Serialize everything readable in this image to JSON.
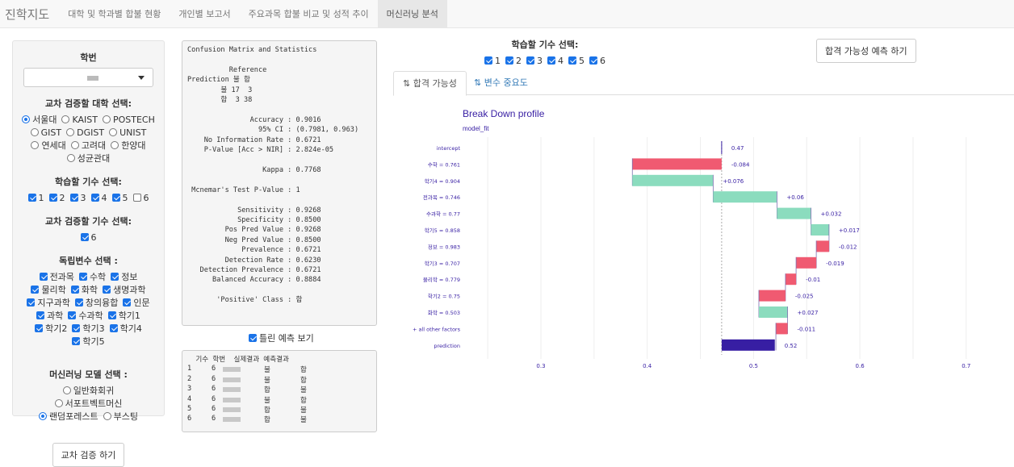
{
  "nav": {
    "brand": "진학지도",
    "items": [
      {
        "label": "대학 및 학과별 합불 현황"
      },
      {
        "label": "개인별 보고서"
      },
      {
        "label": "주요과목 합불 비교 및 성적 추이"
      },
      {
        "label": "머신러닝 분석",
        "active": true
      }
    ]
  },
  "sidebar": {
    "student_label": "학번",
    "univ_label": "교차 검증할 대학 선택:",
    "univs": [
      {
        "label": "서울대",
        "on": true
      },
      {
        "label": "KAIST"
      },
      {
        "label": "POSTECH"
      },
      {
        "label": "GIST"
      },
      {
        "label": "DGIST"
      },
      {
        "label": "UNIST"
      },
      {
        "label": "연세대"
      },
      {
        "label": "고려대"
      },
      {
        "label": "한양대"
      },
      {
        "label": "성균관대"
      }
    ],
    "train_label": "학습할 기수 선택:",
    "train": [
      {
        "label": "1",
        "on": true
      },
      {
        "label": "2",
        "on": true
      },
      {
        "label": "3",
        "on": true
      },
      {
        "label": "4",
        "on": true
      },
      {
        "label": "5",
        "on": true
      },
      {
        "label": "6",
        "on": false
      }
    ],
    "cv_label": "교차 검증할 기수 선택:",
    "cv": [
      {
        "label": "6",
        "on": true
      }
    ],
    "vars_label": "독립변수 선택 :",
    "vars": [
      {
        "label": "전과목"
      },
      {
        "label": "수학"
      },
      {
        "label": "정보"
      },
      {
        "label": "물리학"
      },
      {
        "label": "화학"
      },
      {
        "label": "생명과학"
      },
      {
        "label": "지구과학"
      },
      {
        "label": "창의융합"
      },
      {
        "label": "인문"
      },
      {
        "label": "과학"
      },
      {
        "label": "수과학"
      },
      {
        "label": "학기1"
      },
      {
        "label": "학기2"
      },
      {
        "label": "학기3"
      },
      {
        "label": "학기4"
      },
      {
        "label": "학기5"
      }
    ],
    "model_label": "머신러닝 모델 선택 :",
    "models": [
      {
        "label": "일반화회귀"
      },
      {
        "label": "서포트벡트머신"
      },
      {
        "label": "랜덤포레스트",
        "on": true
      },
      {
        "label": "부스팅"
      }
    ],
    "cv_button": "교차 검증 하기"
  },
  "confusion_text": "Confusion Matrix and Statistics\n\n          Reference\nPrediction 불 합\n        불 17  3\n        합  3 38\n\n               Accuracy : 0.9016\n                 95% CI : (0.7981, 0.963)\n    No Information Rate : 0.6721\n    P-Value [Acc > NIR] : 2.824e-05\n\n                  Kappa : 0.7768\n\n Mcnemar's Test P-Value : 1\n\n            Sensitivity : 0.9268\n            Specificity : 0.8500\n         Pos Pred Value : 0.9268\n         Neg Pred Value : 0.8500\n             Prevalence : 0.6721\n         Detection Rate : 0.6230\n   Detection Prevalence : 0.6721\n      Balanced Accuracy : 0.8884\n\n       'Positive' Class : 합",
  "wrong_label": "틀린 예측 보기",
  "wrong_header": "  기수 학번  실제결과 예측결과",
  "wrong_rows": [
    {
      "n": "1",
      "g": "6",
      "a": "불",
      "p": "합"
    },
    {
      "n": "2",
      "g": "6",
      "a": "불",
      "p": "합"
    },
    {
      "n": "3",
      "g": "6",
      "a": "합",
      "p": "불"
    },
    {
      "n": "4",
      "g": "6",
      "a": "불",
      "p": "합"
    },
    {
      "n": "5",
      "g": "6",
      "a": "합",
      "p": "불"
    },
    {
      "n": "6",
      "g": "6",
      "a": "합",
      "p": "불"
    }
  ],
  "right": {
    "train_label": "학습할 기수 선택:",
    "train": [
      {
        "label": "1"
      },
      {
        "label": "2"
      },
      {
        "label": "3"
      },
      {
        "label": "4"
      },
      {
        "label": "5"
      },
      {
        "label": "6"
      }
    ],
    "predict_button": "합격 가능성 예측 하기",
    "tabs": [
      {
        "label": "합격 가능성",
        "icon": "sort-icon",
        "active": true
      },
      {
        "label": "변수 중요도",
        "icon": "sort-icon"
      }
    ]
  },
  "chart_data": {
    "type": "bar",
    "title": "Break Down profile",
    "subtitle": "model_fit",
    "xlim": [
      0.25,
      0.72
    ],
    "xticks": [
      "0.3",
      "0.4",
      "0.5",
      "0.6",
      "0.7"
    ],
    "grid": true,
    "categories": [
      "intercept",
      "수학 = 0.761",
      "학기4 = 0.904",
      "전과목 = 0.746",
      "수과학 = 0.77",
      "학기5 = 0.858",
      "정보 = 0.983",
      "학기3 = 0.707",
      "물리학 = 0.779",
      "학기2 = 0.75",
      "화학 = 0.503",
      "+ all other factors",
      "prediction"
    ],
    "values": [
      0.47,
      -0.084,
      0.076,
      0.06,
      0.032,
      0.017,
      -0.012,
      -0.019,
      -0.01,
      -0.025,
      0.027,
      -0.011,
      0.52
    ],
    "labels": [
      "0.47",
      "-0.084",
      "+0.076",
      "+0.06",
      "+0.032",
      "+0.017",
      "-0.012",
      "-0.019",
      "-0.01",
      "-0.025",
      "+0.027",
      "-0.011",
      "0.52"
    ],
    "colors": {
      "positive": "#8bdcbe",
      "negative": "#f05a71",
      "prediction": "#371ea3",
      "text": "#371ea3"
    }
  }
}
